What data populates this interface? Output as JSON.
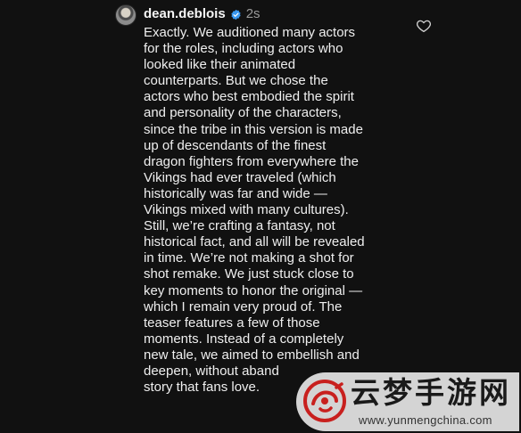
{
  "comment": {
    "username": "dean.deblois",
    "timestamp": "2s",
    "verified_icon": "verified-badge-icon",
    "like_icon": "heart-outline-icon",
    "lines": [
      "Exactly. We auditioned many actors",
      "for the roles, including actors who",
      "looked like their animated",
      "counterparts. But we chose the",
      "actors who best embodied the spirit",
      "and personality of the characters,",
      "since the tribe in this version is made",
      "up of descendants of the finest",
      "dragon fighters from everywhere the",
      "Vikings had ever traveled (which",
      "historically was far and wide —",
      "Vikings mixed with many cultures).",
      "Still, we’re crafting a fantasy, not",
      "historical fact, and all will be revealed",
      "in time. We’re not making a shot for",
      "shot remake. We just stuck close to",
      "key moments to honor the original —",
      "which I remain very proud of. The",
      "teaser features a few of those",
      "moments. Instead of a completely",
      "new tale, we aimed to embellish and",
      "deepen, without aband",
      "story that fans love."
    ]
  },
  "watermark": {
    "title": "云梦手游网",
    "url": "www.yunmengchina.com",
    "logo_icon": "cloud-logo-icon"
  },
  "colors": {
    "background": "#111111",
    "text": "#efefef",
    "muted": "#9a9a9a",
    "verified": "#3897f0",
    "watermark_red": "#c8201e"
  }
}
